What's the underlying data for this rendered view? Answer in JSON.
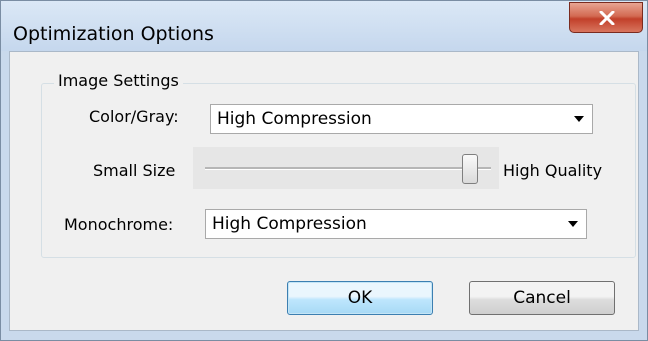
{
  "window": {
    "title": "Optimization Options",
    "close_icon": "close-icon"
  },
  "image_settings": {
    "group_label": "Image Settings",
    "color_gray_label": "Color/Gray:",
    "color_gray_value": "High Compression",
    "slider_left_label": "Small Size",
    "slider_right_label": "High Quality",
    "slider_level_fraction": 0.95,
    "monochrome_label": "Monochrome:",
    "monochrome_value": "High Compression"
  },
  "buttons": {
    "ok_label": "OK",
    "cancel_label": "Cancel"
  },
  "colors": {
    "close_button": "#c2402a",
    "default_button_border": "#3c7fb1"
  }
}
